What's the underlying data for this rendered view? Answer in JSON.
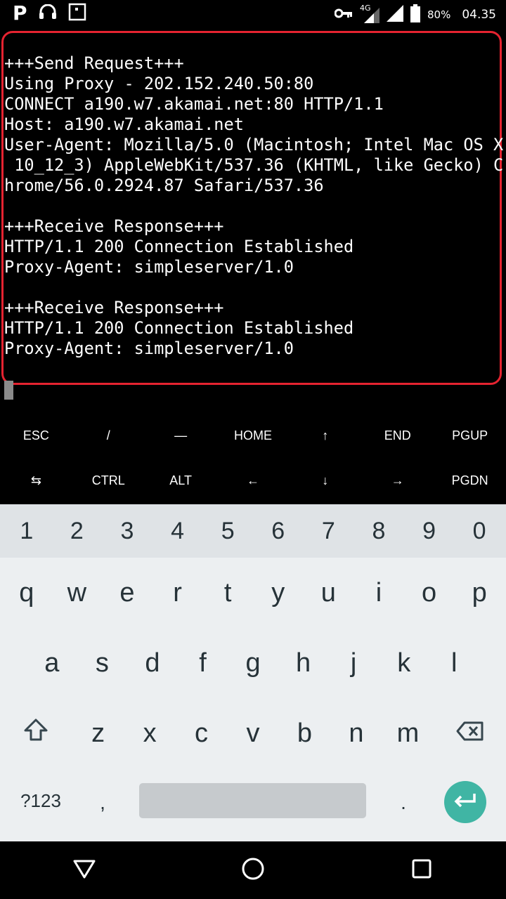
{
  "status_bar": {
    "app_icon": "P",
    "icons": [
      "p-icon",
      "headset-icon",
      "screenshot-icon",
      "key-icon",
      "signal-4g-icon",
      "signal-icon",
      "battery-icon"
    ],
    "network": "4G",
    "battery": "80%",
    "time": "04.35"
  },
  "terminal": {
    "lines": [
      "+++Send Request+++",
      "Using Proxy - 202.152.240.50:80",
      "CONNECT a190.w7.akamai.net:80 HTTP/1.1",
      "Host: a190.w7.akamai.net",
      "User-Agent: Mozilla/5.0 (Macintosh; Intel Mac OS X",
      " 10_12_3) AppleWebKit/537.36 (KHTML, like Gecko) C",
      "hrome/56.0.2924.87 Safari/537.36",
      "",
      "+++Receive Response+++",
      "HTTP/1.1 200 Connection Established",
      "Proxy-Agent: simpleserver/1.0",
      "",
      "+++Receive Response+++",
      "HTTP/1.1 200 Connection Established",
      "Proxy-Agent: simpleserver/1.0"
    ],
    "highlight_color": "#e52330"
  },
  "extra_keys": {
    "row1": [
      "ESC",
      "/",
      "—",
      "HOME",
      "↑",
      "END",
      "PGUP"
    ],
    "row2": [
      "⇆",
      "CTRL",
      "ALT",
      "←",
      "↓",
      "→",
      "PGDN"
    ]
  },
  "keyboard": {
    "numbers": [
      "1",
      "2",
      "3",
      "4",
      "5",
      "6",
      "7",
      "8",
      "9",
      "0"
    ],
    "row_q": [
      "q",
      "w",
      "e",
      "r",
      "t",
      "y",
      "u",
      "i",
      "o",
      "p"
    ],
    "row_a": [
      "a",
      "s",
      "d",
      "f",
      "g",
      "h",
      "j",
      "k",
      "l"
    ],
    "row_z": [
      "z",
      "x",
      "c",
      "v",
      "b",
      "n",
      "m"
    ],
    "symbols_label": "?123",
    "comma": ",",
    "period": ".",
    "enter_color": "#40b5a4"
  },
  "nav_bar": {
    "icons": [
      "back-icon",
      "home-icon",
      "recents-icon"
    ]
  }
}
